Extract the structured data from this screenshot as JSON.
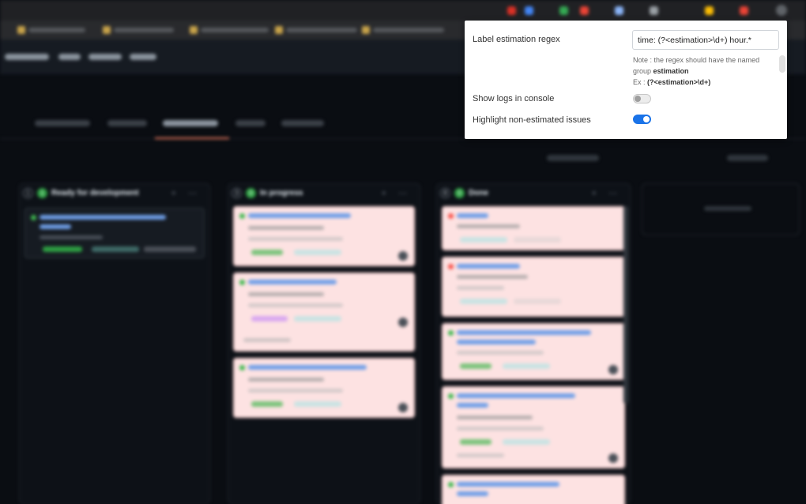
{
  "popup": {
    "regex_label": "Label estimation regex",
    "regex_value": "time: (?<estimation>\\d+) hour.*",
    "note_line1": "Note : the regex should have the named group",
    "note_group": "estimation",
    "note_ex_prefix": "Ex :",
    "note_ex_value": "(?<estimation>\\d+)",
    "show_logs_label": "Show logs in console",
    "show_logs_enabled": false,
    "highlight_label": "Highlight non-estimated issues",
    "highlight_enabled": true
  },
  "board": {
    "columns": [
      {
        "count": "1",
        "items": "1",
        "title": "Ready for development"
      },
      {
        "count": "3",
        "items": "0",
        "title": "In progress"
      },
      {
        "count": "8",
        "items": "0",
        "title": "Done"
      }
    ]
  },
  "colors": {
    "toggle_on": "#1a73e8",
    "card_highlight": "#fde2e2",
    "count_green": "#2ea043"
  }
}
